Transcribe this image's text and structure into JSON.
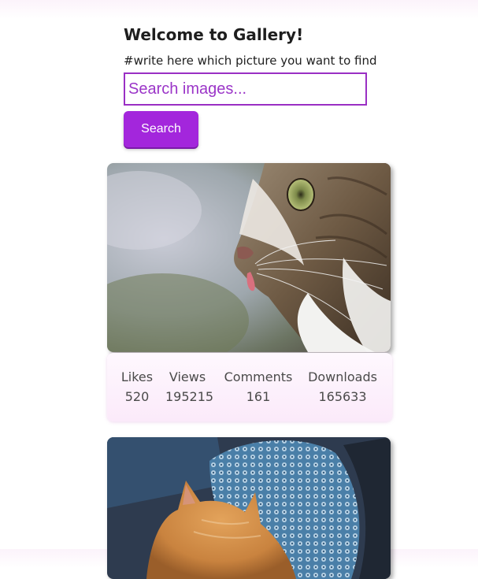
{
  "header": {
    "title": "Welcome to Gallery!",
    "subtitle": "#write here which picture you want to find"
  },
  "search": {
    "placeholder": "Search images...",
    "value": "",
    "button_label": "Search"
  },
  "gallery": {
    "cards": [
      {
        "image_subject": "tabby cat profile with tongue out",
        "stats": {
          "likes_label": "Likes",
          "likes": "520",
          "views_label": "Views",
          "views": "195215",
          "comments_label": "Comments",
          "comments": "161",
          "downloads_label": "Downloads",
          "downloads": "165633"
        }
      },
      {
        "image_subject": "orange cat resting against blue patterned pillow"
      }
    ]
  },
  "colors": {
    "accent": "#a326dc",
    "input_border": "#9a2fc4",
    "stats_bg": "#fbeafa"
  }
}
